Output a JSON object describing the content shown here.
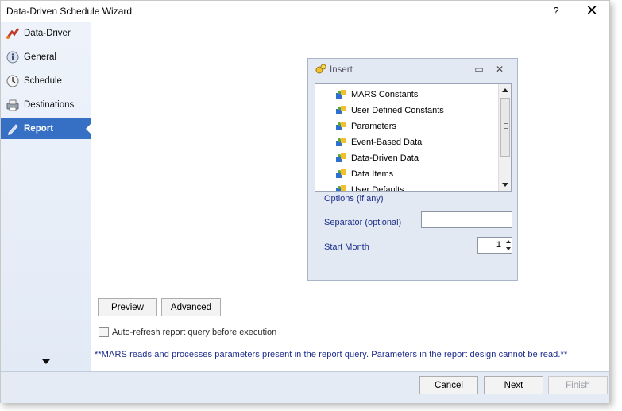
{
  "window": {
    "title": "Data-Driven Schedule Wizard",
    "help_label": "?",
    "close_label": "✕"
  },
  "sidebar": {
    "items": [
      {
        "label": "Data-Driver",
        "icon": "data-driver-icon",
        "active": false
      },
      {
        "label": "General",
        "icon": "info-icon",
        "active": false
      },
      {
        "label": "Schedule",
        "icon": "clock-icon",
        "active": false
      },
      {
        "label": "Destinations",
        "icon": "printer-icon",
        "active": false
      },
      {
        "label": "Report",
        "icon": "pencil-icon",
        "active": true
      }
    ]
  },
  "insert_panel": {
    "title": "Insert",
    "minimize_label": "▭",
    "close_label": "✕",
    "tree_items": [
      {
        "label": "MARS Constants"
      },
      {
        "label": "User Defined Constants"
      },
      {
        "label": "Parameters"
      },
      {
        "label": "Event-Based Data"
      },
      {
        "label": "Data-Driven Data"
      },
      {
        "label": "Data Items"
      },
      {
        "label": "User Defaults"
      }
    ],
    "options_label": "Options (if any)",
    "separator_label": "Separator (optional)",
    "separator_value": "",
    "start_month_label": "Start Month",
    "start_month_value": "1"
  },
  "actions": {
    "preview_label": "Preview",
    "advanced_label": "Advanced",
    "auto_refresh_label": "Auto-refresh report query before execution",
    "auto_refresh_checked": false
  },
  "note": "**MARS reads and processes  parameters present in the report query.  Parameters in the report design cannot be read.**",
  "footer": {
    "cancel_label": "Cancel",
    "next_label": "Next",
    "finish_label": "Finish"
  },
  "colors": {
    "active_nav": "#3570c4",
    "label_blue": "#1c2f8c",
    "panel_bg": "#e3e9f3"
  }
}
